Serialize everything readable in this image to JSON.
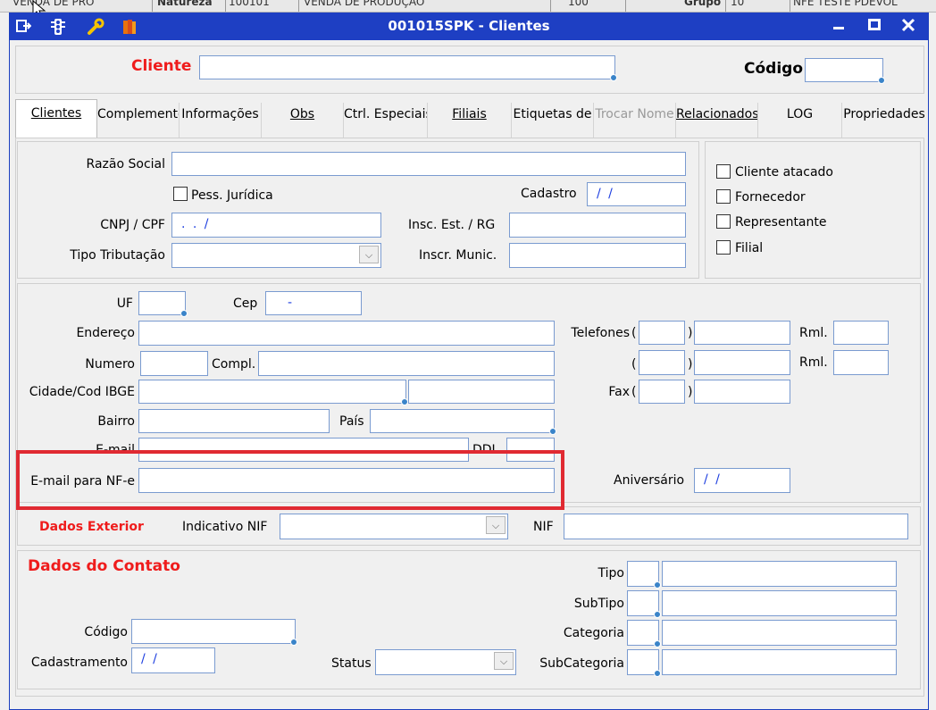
{
  "window": {
    "title": "001015SPK - Clientes"
  },
  "background_strip": [
    "VENDA DE PRO",
    "Natureza",
    "100101",
    "VENDA DE PRODUÇÃO",
    "100",
    "Grupo",
    "10",
    "NFE TESTE PDEVOL"
  ],
  "search": {
    "cliente_label": "Cliente",
    "codigo_label": "Código",
    "cliente_value": "",
    "codigo_value": ""
  },
  "tabs": [
    {
      "label": "Clientes",
      "state": "active"
    },
    {
      "label": "Complementos",
      "state": "normal"
    },
    {
      "label": "Informações",
      "state": "normal"
    },
    {
      "label": "Obs",
      "state": "normal"
    },
    {
      "label": "Ctrl. Especiais",
      "state": "normal"
    },
    {
      "label": "Filiais",
      "state": "normal"
    },
    {
      "label": "Etiquetas de",
      "state": "normal"
    },
    {
      "label": "Trocar Nome",
      "state": "disabled"
    },
    {
      "label": "Relacionados",
      "state": "normal"
    },
    {
      "label": "LOG",
      "state": "normal"
    },
    {
      "label": "Propriedades",
      "state": "normal"
    }
  ],
  "geral": {
    "razao_social": "Razão Social",
    "pess_juridica": "Pess. Jurídica",
    "cadastro": "Cadastro",
    "cadastro_value": "/ /",
    "cnpj": "CNPJ / CPF",
    "cnpj_value": ". . /",
    "insc_est": "Insc. Est. / RG",
    "tipo_tributacao": "Tipo Tributação",
    "inscr_munic": "Inscr. Munic."
  },
  "flags": {
    "cliente_atacado": "Cliente atacado",
    "fornecedor": "Fornecedor",
    "representante": "Representante",
    "filial": "Filial"
  },
  "endereco": {
    "uf": "UF",
    "cep": "Cep",
    "cep_value": "-",
    "endereco": "Endereço",
    "numero": "Numero",
    "compl": "Compl.",
    "cidade": "Cidade/Cod IBGE",
    "bairro": "Bairro",
    "pais": "País",
    "email": "E-mail",
    "ddi": "DDI",
    "email_nfe": "E-mail para NF-e",
    "telefones": "Telefones",
    "paren_open": "(",
    "paren_close": ")",
    "rml": "Rml.",
    "fax": "Fax",
    "aniversario": "Aniversário",
    "aniversario_value": "/ /"
  },
  "exterior": {
    "title": "Dados Exterior",
    "indicativo_nif": "Indicativo NIF",
    "nif": "NIF"
  },
  "contato": {
    "title": "Dados do Contato",
    "tipo": "Tipo",
    "subtipo": "SubTipo",
    "categoria": "Categoria",
    "subcategoria": "SubCategoria",
    "codigo": "Código",
    "cadastramento": "Cadastramento",
    "cadastramento_value": "/ /",
    "status": "Status"
  },
  "colors": {
    "titlebar": "#1e3fc3",
    "required_label": "#ef1c1c",
    "date_mask": "#1e3fe0",
    "highlight": "#e02a32"
  }
}
